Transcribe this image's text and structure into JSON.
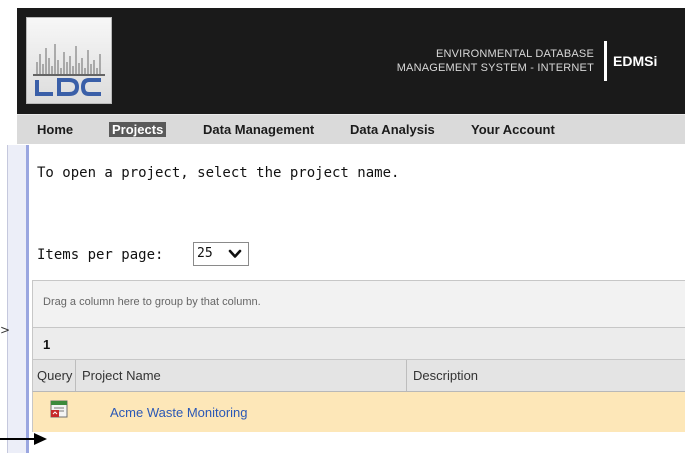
{
  "header": {
    "logo_text": "LDC",
    "title_line1": "ENVIRONMENTAL DATABASE",
    "title_line2": "MANAGEMENT SYSTEM - INTERNET",
    "acronym": "EDMSi"
  },
  "nav": {
    "items": [
      {
        "label": "Home"
      },
      {
        "label": "Projects",
        "active": true
      },
      {
        "label": "Data Management"
      },
      {
        "label": "Data Analysis"
      },
      {
        "label": "Your Account"
      }
    ]
  },
  "left_pane": {
    "expand_glyph": ">"
  },
  "content": {
    "instruction": "To open a project, select the project name.",
    "items_per_page_label": "Items per page:",
    "items_per_page_value": "25"
  },
  "grid": {
    "group_panel_hint": "Drag a column here to group by that column.",
    "group_value": "1",
    "columns": [
      {
        "label": "Query"
      },
      {
        "label": "Project Name"
      },
      {
        "label": "Description"
      }
    ],
    "rows": [
      {
        "query_icon": "query-report-icon",
        "project_name": "Acme Waste Monitoring",
        "description": ""
      }
    ]
  },
  "icons": {
    "logo": "ldc-logo-icon",
    "select_arrow": "chevron-down-icon",
    "query": "query-report-icon",
    "callout": "arrow-right-icon"
  },
  "colors": {
    "header_bg": "#1a1a1a",
    "nav_bg": "#dadada",
    "nav_active_bg": "#5a5a5a",
    "row_highlight": "#fde7b8",
    "link": "#2b58b6",
    "pane_accent": "#9aa6e0"
  }
}
